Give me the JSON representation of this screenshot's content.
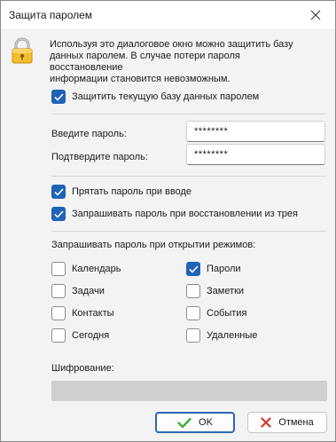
{
  "window": {
    "title": "Защита паролем"
  },
  "info": {
    "line1": "Используя это диалоговое окно можно защитить базу",
    "line2": "данных паролем. В случае потери пароля восстановление",
    "line3": "информации становится невозможным."
  },
  "protect_db": {
    "label": "Защитить текущую базу данных паролем",
    "checked": true
  },
  "password": {
    "label": "Введите пароль:",
    "value": "********"
  },
  "confirm": {
    "label": "Подтвердите пароль:",
    "value": "********"
  },
  "hide_password": {
    "label": "Прятать пароль при вводе",
    "checked": true
  },
  "ask_on_restore": {
    "label": "Запрашивать пароль при восстановлении из трея",
    "checked": true
  },
  "modes": {
    "heading": "Запрашивать пароль при открытии режимов:",
    "items": [
      {
        "label": "Календарь",
        "checked": false
      },
      {
        "label": "Пароли",
        "checked": true
      },
      {
        "label": "Задачи",
        "checked": false
      },
      {
        "label": "Заметки",
        "checked": false
      },
      {
        "label": "Контакты",
        "checked": false
      },
      {
        "label": "События",
        "checked": false
      },
      {
        "label": "Сегодня",
        "checked": false
      },
      {
        "label": "Удаленные",
        "checked": false
      }
    ]
  },
  "encryption": {
    "label": "Шифрование:",
    "value": ""
  },
  "buttons": {
    "ok": "OK",
    "cancel": "Отмена"
  },
  "icons": {
    "lock": "lock-icon",
    "close": "close-icon",
    "ok": "checkmark-icon",
    "cancel": "cross-icon"
  },
  "colors": {
    "accent": "#1f63b6",
    "ok_check": "#3fae3f",
    "cancel_x": "#d23a2c"
  }
}
